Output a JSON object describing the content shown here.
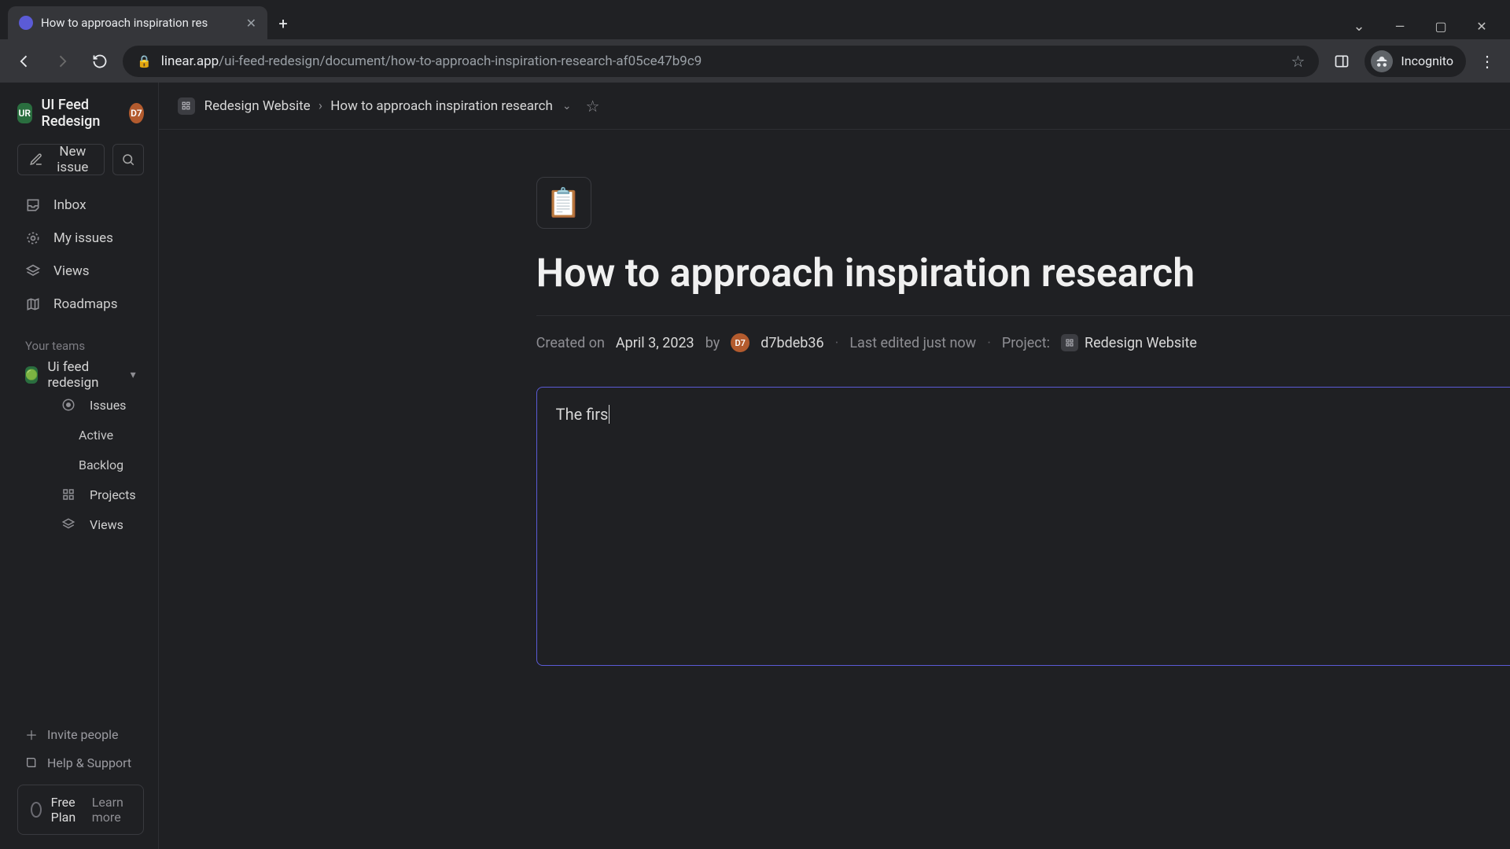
{
  "browser": {
    "tab_title": "How to approach inspiration res",
    "url_host": "linear.app",
    "url_path": "/ui-feed-redesign/document/how-to-approach-inspiration-research-af05ce47b9c9",
    "incognito_label": "Incognito"
  },
  "sidebar": {
    "workspace_badge": "UR",
    "workspace_name": "UI Feed Redesign",
    "user_chip": "D7",
    "new_issue_label": "New issue",
    "nav": {
      "inbox": "Inbox",
      "my_issues": "My issues",
      "views": "Views",
      "roadmaps": "Roadmaps"
    },
    "teams_label": "Your teams",
    "team_name": "Ui feed redesign",
    "team_children": {
      "issues": "Issues",
      "active": "Active",
      "backlog": "Backlog",
      "projects": "Projects",
      "views": "Views"
    },
    "invite_label": "Invite people",
    "help_label": "Help & Support",
    "plan_name": "Free Plan",
    "learn_more": "Learn more"
  },
  "topbar": {
    "project": "Redesign Website",
    "separator": "›",
    "doc": "How to approach inspiration research"
  },
  "document": {
    "emoji": "📋",
    "title": "How to approach inspiration research",
    "created_prefix": "Created on",
    "created_date": "April 3, 2023",
    "by_word": "by",
    "author_chip": "D7",
    "author_name": "d7bdeb36",
    "last_edited": "Last edited just now",
    "project_label": "Project:",
    "project_name": "Redesign Website",
    "body_text": "The firs"
  }
}
